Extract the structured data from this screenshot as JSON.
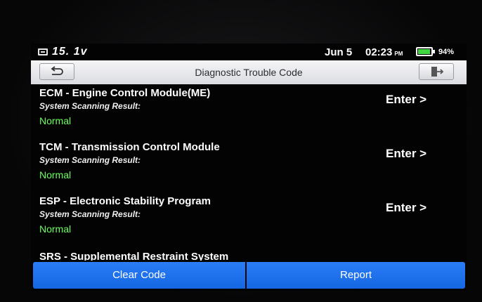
{
  "status": {
    "voltage": "15. 1v",
    "date": "Jun 5",
    "time": "02:23",
    "ampm": "PM",
    "battery_percent": "94%",
    "battery_level": 0.94,
    "battery_color": "#3fd63f"
  },
  "header": {
    "title": "Diagnostic Trouble Code",
    "back_icon": "back-arrow-icon",
    "exit_icon": "exit-door-icon"
  },
  "modules": [
    {
      "name": "ECM - Engine Control Module(ME)",
      "result_label": "System Scanning Result:",
      "result": "Normal",
      "enter_label": "Enter >"
    },
    {
      "name": "TCM - Transmission Control Module",
      "result_label": "System Scanning Result:",
      "result": "Normal",
      "enter_label": "Enter >"
    },
    {
      "name": "ESP - Electronic Stability Program",
      "result_label": "System Scanning Result:",
      "result": "Normal",
      "enter_label": "Enter >"
    },
    {
      "name": "SRS - Supplemental Restraint System"
    }
  ],
  "footer": {
    "clear_label": "Clear Code",
    "report_label": "Report",
    "button_color": "#1f72ec"
  },
  "colors": {
    "normal_status": "#6bff5e",
    "accent_blue": "#1f72ec"
  }
}
